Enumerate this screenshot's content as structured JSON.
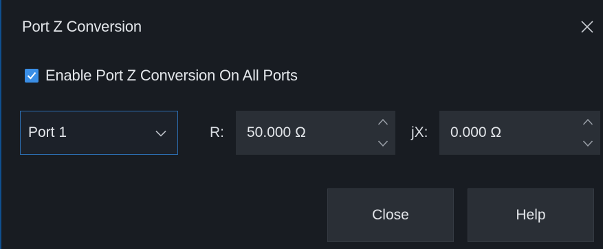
{
  "dialog": {
    "title": "Port Z Conversion"
  },
  "enable": {
    "label": "Enable Port Z Conversion On All Ports",
    "checked": true
  },
  "port_select": {
    "selected": "Port 1"
  },
  "r_field": {
    "label": "R:",
    "value": "50.000 Ω"
  },
  "jx_field": {
    "label": "jX:",
    "value": "0.000 Ω"
  },
  "buttons": {
    "close_label": "Close",
    "help_label": "Help"
  },
  "colors": {
    "background": "#181c22",
    "accent": "#3a8ee6",
    "field_bg": "#2a2f36"
  },
  "icons": {
    "close": "close-icon",
    "check": "checkmark-icon",
    "dropdown": "chevron-down-icon",
    "spin_up": "chevron-up-icon",
    "spin_down": "chevron-down-icon"
  }
}
